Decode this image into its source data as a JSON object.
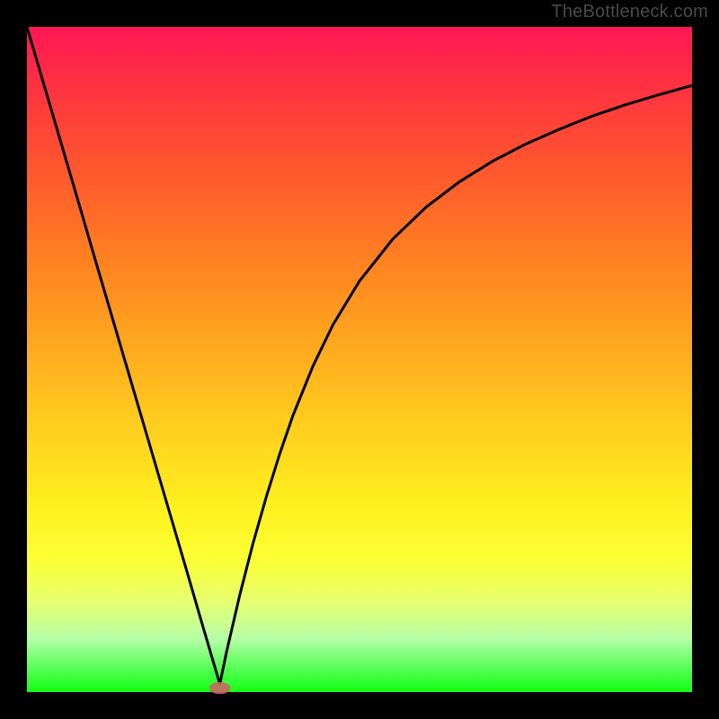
{
  "watermark": "TheBottleneck.com",
  "chart_data": {
    "type": "line",
    "title": "",
    "xlabel": "",
    "ylabel": "",
    "xlim": [
      0,
      1
    ],
    "ylim": [
      0,
      1
    ],
    "series": [
      {
        "name": "left-branch",
        "x": [
          0.0,
          0.02,
          0.04,
          0.06,
          0.08,
          0.1,
          0.12,
          0.14,
          0.16,
          0.18,
          0.2,
          0.22,
          0.24,
          0.26,
          0.28,
          0.29
        ],
        "y": [
          1.0,
          0.932,
          0.864,
          0.796,
          0.728,
          0.659,
          0.591,
          0.523,
          0.455,
          0.387,
          0.319,
          0.251,
          0.183,
          0.114,
          0.046,
          0.012
        ]
      },
      {
        "name": "right-branch",
        "x": [
          0.29,
          0.3,
          0.32,
          0.34,
          0.36,
          0.38,
          0.4,
          0.43,
          0.46,
          0.5,
          0.55,
          0.6,
          0.65,
          0.7,
          0.75,
          0.8,
          0.85,
          0.9,
          0.95,
          1.0
        ],
        "y": [
          0.012,
          0.06,
          0.146,
          0.224,
          0.294,
          0.358,
          0.416,
          0.49,
          0.552,
          0.618,
          0.681,
          0.729,
          0.767,
          0.798,
          0.824,
          0.846,
          0.866,
          0.883,
          0.898,
          0.912
        ]
      }
    ],
    "marker": {
      "x": 0.29,
      "y": 0.006,
      "rx": 0.016,
      "ry": 0.009,
      "fill": "#cd6464"
    },
    "background_gradient": {
      "stops": [
        {
          "pos": 0.0,
          "color": "#ff1753"
        },
        {
          "pos": 0.12,
          "color": "#ff3b3c"
        },
        {
          "pos": 0.24,
          "color": "#ff5f2b"
        },
        {
          "pos": 0.36,
          "color": "#ff8421"
        },
        {
          "pos": 0.48,
          "color": "#ffa91e"
        },
        {
          "pos": 0.6,
          "color": "#ffce1e"
        },
        {
          "pos": 0.72,
          "color": "#fff01f"
        },
        {
          "pos": 0.8,
          "color": "#fbff33"
        },
        {
          "pos": 0.86,
          "color": "#e9ff6c"
        },
        {
          "pos": 0.92,
          "color": "#b6ffa6"
        },
        {
          "pos": 0.96,
          "color": "#5eff5e"
        },
        {
          "pos": 1.0,
          "color": "#14ff14"
        }
      ]
    },
    "frame_color": "#000000"
  }
}
